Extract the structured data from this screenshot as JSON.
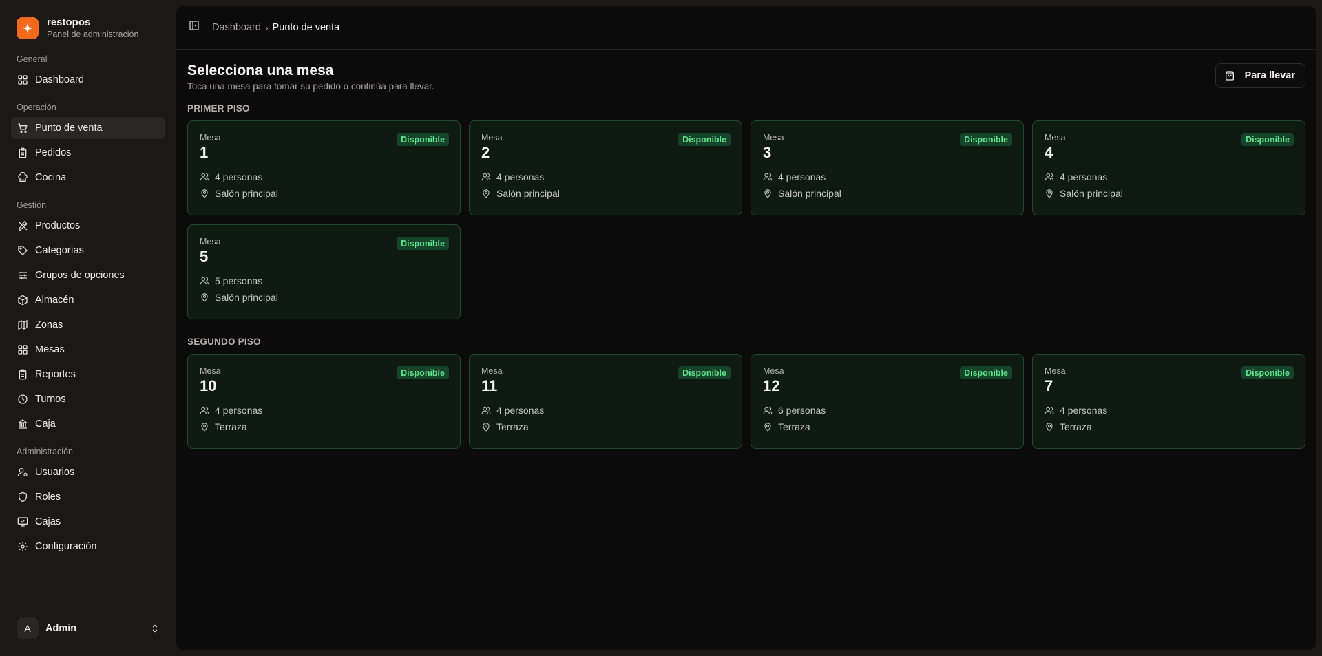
{
  "brand": {
    "name": "restopos",
    "subtitle": "Panel de administración",
    "accent": "#f26b1d"
  },
  "nav": {
    "groups": [
      {
        "label": "General",
        "items": [
          {
            "label": "Dashboard",
            "icon": "grid-icon"
          }
        ]
      },
      {
        "label": "Operación",
        "items": [
          {
            "label": "Punto de venta",
            "icon": "cart-icon",
            "active": true
          },
          {
            "label": "Pedidos",
            "icon": "clipboard-icon"
          },
          {
            "label": "Cocina",
            "icon": "chef-hat-icon"
          }
        ]
      },
      {
        "label": "Gestión",
        "items": [
          {
            "label": "Productos",
            "icon": "utensils-icon"
          },
          {
            "label": "Categorías",
            "icon": "tag-icon"
          },
          {
            "label": "Grupos de opciones",
            "icon": "sliders-icon"
          },
          {
            "label": "Almacén",
            "icon": "package-icon"
          },
          {
            "label": "Zonas",
            "icon": "map-icon"
          },
          {
            "label": "Mesas",
            "icon": "grid-icon"
          },
          {
            "label": "Reportes",
            "icon": "clipboard-icon"
          },
          {
            "label": "Turnos",
            "icon": "clock-icon"
          },
          {
            "label": "Caja",
            "icon": "landmark-icon"
          }
        ]
      },
      {
        "label": "Administración",
        "items": [
          {
            "label": "Usuarios",
            "icon": "user-cog-icon"
          },
          {
            "label": "Roles",
            "icon": "shield-icon"
          },
          {
            "label": "Cajas",
            "icon": "monitor-check-icon"
          },
          {
            "label": "Configuración",
            "icon": "gear-icon"
          }
        ]
      }
    ]
  },
  "user": {
    "initial": "A",
    "name": "Admin"
  },
  "breadcrumb": {
    "parent": "Dashboard",
    "separator": "›",
    "current": "Punto de venta"
  },
  "page": {
    "title": "Selecciona una mesa",
    "subtitle": "Toca una mesa para tomar su pedido o continúa para llevar.",
    "takeaway_label": "Para llevar"
  },
  "sections": [
    {
      "title": "PRIMER PISO",
      "tables": [
        {
          "label": "Mesa",
          "number": "1",
          "status": "Disponible",
          "capacity": "4 personas",
          "zone": "Salón principal"
        },
        {
          "label": "Mesa",
          "number": "2",
          "status": "Disponible",
          "capacity": "4 personas",
          "zone": "Salón principal"
        },
        {
          "label": "Mesa",
          "number": "3",
          "status": "Disponible",
          "capacity": "4 personas",
          "zone": "Salón principal"
        },
        {
          "label": "Mesa",
          "number": "4",
          "status": "Disponible",
          "capacity": "4 personas",
          "zone": "Salón principal"
        },
        {
          "label": "Mesa",
          "number": "5",
          "status": "Disponible",
          "capacity": "5 personas",
          "zone": "Salón principal"
        }
      ]
    },
    {
      "title": "SEGUNDO PISO",
      "tables": [
        {
          "label": "Mesa",
          "number": "10",
          "status": "Disponible",
          "capacity": "4 personas",
          "zone": "Terraza"
        },
        {
          "label": "Mesa",
          "number": "11",
          "status": "Disponible",
          "capacity": "4 personas",
          "zone": "Terraza"
        },
        {
          "label": "Mesa",
          "number": "12",
          "status": "Disponible",
          "capacity": "6 personas",
          "zone": "Terraza"
        },
        {
          "label": "Mesa",
          "number": "7",
          "status": "Disponible",
          "capacity": "4 personas",
          "zone": "Terraza"
        }
      ]
    }
  ],
  "colors": {
    "available_badge_bg": "#15442a",
    "available_badge_text": "#5fe28d",
    "card_border": "#1f4a2c"
  }
}
